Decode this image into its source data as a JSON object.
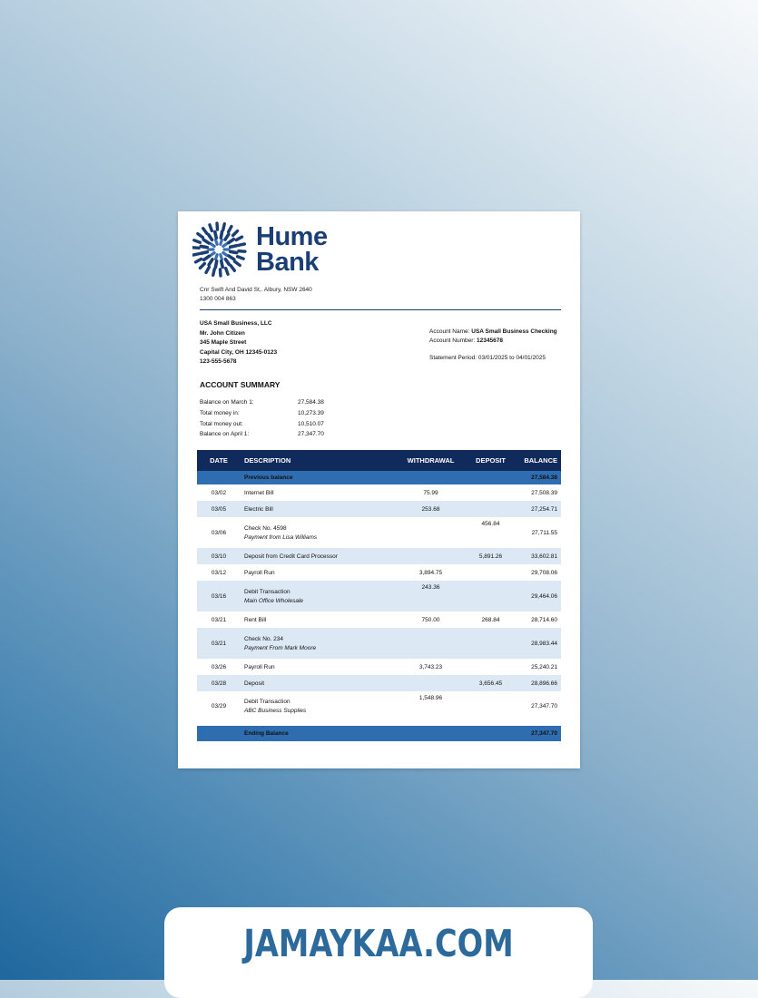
{
  "bank": {
    "name_line1": "Hume",
    "name_line2": "Bank",
    "address": "Cnr Swift And David St,. Albury, NSW 2640",
    "phone": "1300 004 863",
    "brand_color": "#1b3f75"
  },
  "customer": {
    "company": "USA Small Business, LLC",
    "name": "Mr. John Citizen",
    "street": "345 Maple Street",
    "city": "Capital City, OH 12345-0123",
    "phone": "123-555-5678"
  },
  "account": {
    "name_label": "Account Name:",
    "name_value": "USA Small Business Checking",
    "number_label": "Account Number:",
    "number_value": "12345678",
    "period_label": "Statement Period:",
    "period_value": "03/01/2025 to 04/01/2025"
  },
  "summary": {
    "title": "ACCOUNT SUMMARY",
    "rows": [
      {
        "label": "Balance on March 1:",
        "value": "27,584.38"
      },
      {
        "label": "Total money in:",
        "value": "10,273.39"
      },
      {
        "label": "Total money out:",
        "value": "10,510.07"
      },
      {
        "label": "Balance on April 1:",
        "value": "27,347.70"
      }
    ]
  },
  "table": {
    "headers": {
      "date": "DATE",
      "description": "DESCRIPTION",
      "withdrawal": "WITHDRAWAL",
      "deposit": "DEPOSIT",
      "balance": "BALANCE"
    },
    "previous": {
      "label": "Previous balance",
      "balance": "27,584.38"
    },
    "rows": [
      {
        "date": "03/02",
        "desc": "Internet Bill",
        "sub": "",
        "withdrawal": "75.99",
        "deposit": "",
        "balance": "27,508.39"
      },
      {
        "date": "03/05",
        "desc": "Electric Bill",
        "sub": "",
        "withdrawal": "253.68",
        "deposit": "",
        "balance": "27,254.71"
      },
      {
        "date": "03/06",
        "desc": "Check No. 4598",
        "sub": "Payment from Lisa Williams",
        "withdrawal": "",
        "deposit": "456.84",
        "balance": "27,711.55"
      },
      {
        "date": "03/10",
        "desc": "Deposit from Credit Card Processor",
        "sub": "",
        "withdrawal": "",
        "deposit": "5,891.26",
        "balance": "33,602.81"
      },
      {
        "date": "03/12",
        "desc": "Payroll Run",
        "sub": "",
        "withdrawal": "3,894.75",
        "deposit": "",
        "balance": "29,708.06"
      },
      {
        "date": "03/16",
        "desc": "Debit Transaction",
        "sub": "Main Office Wholesale",
        "withdrawal": "243.36",
        "deposit": "",
        "balance": "29,464.06"
      },
      {
        "date": "03/21",
        "desc": "Rent Bill",
        "sub": "",
        "withdrawal": "750.00",
        "deposit": "268.84",
        "balance": "28,714.60"
      },
      {
        "date": "03/21",
        "desc": "Check No. 234",
        "sub": "Payment From Mark Moore",
        "withdrawal": "",
        "deposit": "",
        "balance": "28,983.44"
      },
      {
        "date": "03/26",
        "desc": "Payroll Run",
        "sub": "",
        "withdrawal": "3,743.23",
        "deposit": "",
        "balance": "25,240.21"
      },
      {
        "date": "03/28",
        "desc": "Deposit",
        "sub": "",
        "withdrawal": "",
        "deposit": "3,656.45",
        "balance": "28,896.66"
      },
      {
        "date": "03/29",
        "desc": "Debit Transaction",
        "sub": "ABC Business Supplies",
        "withdrawal": "1,548.96",
        "deposit": "",
        "balance": "27,347.70"
      }
    ],
    "ending": {
      "label": "Ending Balance",
      "balance": "27,347.70"
    },
    "header_color": "#102a5c",
    "accent_color": "#2e6db0",
    "shade_color": "#dce8f4"
  },
  "footer": {
    "text": "JAMAYKAA.COM",
    "color": "#2d6a9c"
  }
}
